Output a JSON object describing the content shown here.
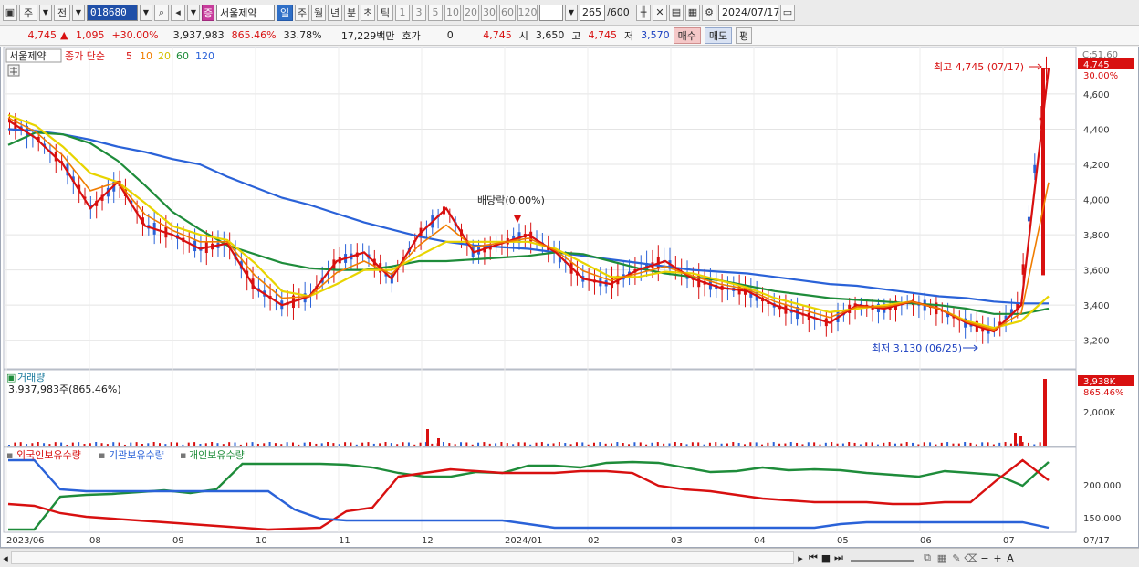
{
  "toolbar": {
    "type_label": "주",
    "prev_label": "전",
    "code": "018680",
    "name": "서울제약",
    "badge": "증",
    "periods": [
      "일",
      "주",
      "월",
      "년",
      "분",
      "초",
      "틱"
    ],
    "active_period": "일",
    "numbers": [
      "1",
      "3",
      "5",
      "10",
      "20",
      "30",
      "60",
      "120"
    ],
    "count": "265",
    "total": "/600",
    "date": "2024/07/17"
  },
  "quote": {
    "price": "4,745",
    "change": "1,095",
    "change_pct": "+30.00%",
    "volume": "3,937,983",
    "vol_ratio": "865.46%",
    "turnover": "33.78%",
    "amount": "17,229백만",
    "hoga_label": "호가",
    "hoga": "0",
    "hoga_price": "4,745",
    "open_label": "시",
    "open": "3,650",
    "high_label": "고",
    "high": "4,745",
    "low_label": "저",
    "low": "3,570",
    "buy": "매수",
    "sell": "매도",
    "eq": "평"
  },
  "price_pane": {
    "stock_name": "서울제약",
    "ma_title": "종가 단순",
    "ma_periods": [
      "5",
      "10",
      "20",
      "60",
      "120"
    ],
    "ma_colors": [
      "#d81010",
      "#f07d00",
      "#e8d400",
      "#1e8c3a",
      "#2a62d8"
    ],
    "y_ticks": [
      "4,600",
      "4,400",
      "4,200",
      "4,000",
      "3,800",
      "3,600",
      "3,400",
      "3,200"
    ],
    "top_label": "C:51.60",
    "price_tag": "4,745",
    "pct_tag": "30.00%",
    "high_note": "최고 4,745 (07/17)",
    "low_note": "최저 3,130 (06/25)",
    "dividend_note": "배당락(0.00%)"
  },
  "volume_pane": {
    "title": "거래량",
    "value": "3,937,983주(865.46%)",
    "tag": "3,938K",
    "tag_pct": "865.46%",
    "tick": "2,000K"
  },
  "holdings_pane": {
    "series": [
      {
        "name": "외국인보유수량",
        "color": "#d81010"
      },
      {
        "name": "기관보유수량",
        "color": "#2a62d8"
      },
      {
        "name": "개인보유수량",
        "color": "#1e8c3a"
      }
    ],
    "ticks": [
      "200,000",
      "150,000"
    ]
  },
  "x_axis": [
    "2023/06",
    "08",
    "09",
    "10",
    "11",
    "12",
    "2024/01",
    "02",
    "03",
    "04",
    "05",
    "06",
    "07"
  ],
  "x_axis_right": "07/17",
  "chart_data": {
    "type": "line",
    "title": "서울제약",
    "y_range": [
      3100,
      4750
    ],
    "ma5": [
      4450,
      4350,
      4200,
      3950,
      4100,
      3850,
      3800,
      3720,
      3750,
      3500,
      3400,
      3450,
      3650,
      3700,
      3550,
      3800,
      3950,
      3700,
      3750,
      3800,
      3700,
      3550,
      3520,
      3600,
      3650,
      3550,
      3500,
      3480,
      3400,
      3350,
      3300,
      3400,
      3380,
      3420,
      3380,
      3300,
      3250,
      3400,
      4745
    ],
    "ma20": [
      4480,
      4420,
      4300,
      4150,
      4100,
      3980,
      3850,
      3800,
      3770,
      3640,
      3480,
      3450,
      3520,
      3600,
      3600,
      3680,
      3760,
      3760,
      3760,
      3760,
      3720,
      3640,
      3560,
      3560,
      3590,
      3580,
      3540,
      3500,
      3440,
      3400,
      3360,
      3380,
      3400,
      3420,
      3380,
      3310,
      3270,
      3310,
      3450
    ],
    "ma60": [
      4310,
      4380,
      4370,
      4320,
      4220,
      4080,
      3930,
      3830,
      3740,
      3690,
      3640,
      3610,
      3600,
      3600,
      3620,
      3650,
      3650,
      3660,
      3670,
      3680,
      3700,
      3690,
      3650,
      3610,
      3580,
      3560,
      3540,
      3510,
      3480,
      3460,
      3440,
      3430,
      3420,
      3410,
      3400,
      3380,
      3350,
      3350,
      3380
    ],
    "ma120": [
      4400,
      4390,
      4370,
      4340,
      4300,
      4270,
      4230,
      4200,
      4130,
      4070,
      4010,
      3970,
      3920,
      3870,
      3830,
      3790,
      3760,
      3740,
      3730,
      3720,
      3700,
      3680,
      3660,
      3640,
      3620,
      3600,
      3590,
      3580,
      3560,
      3540,
      3520,
      3510,
      3490,
      3470,
      3450,
      3440,
      3420,
      3410,
      3410
    ]
  }
}
